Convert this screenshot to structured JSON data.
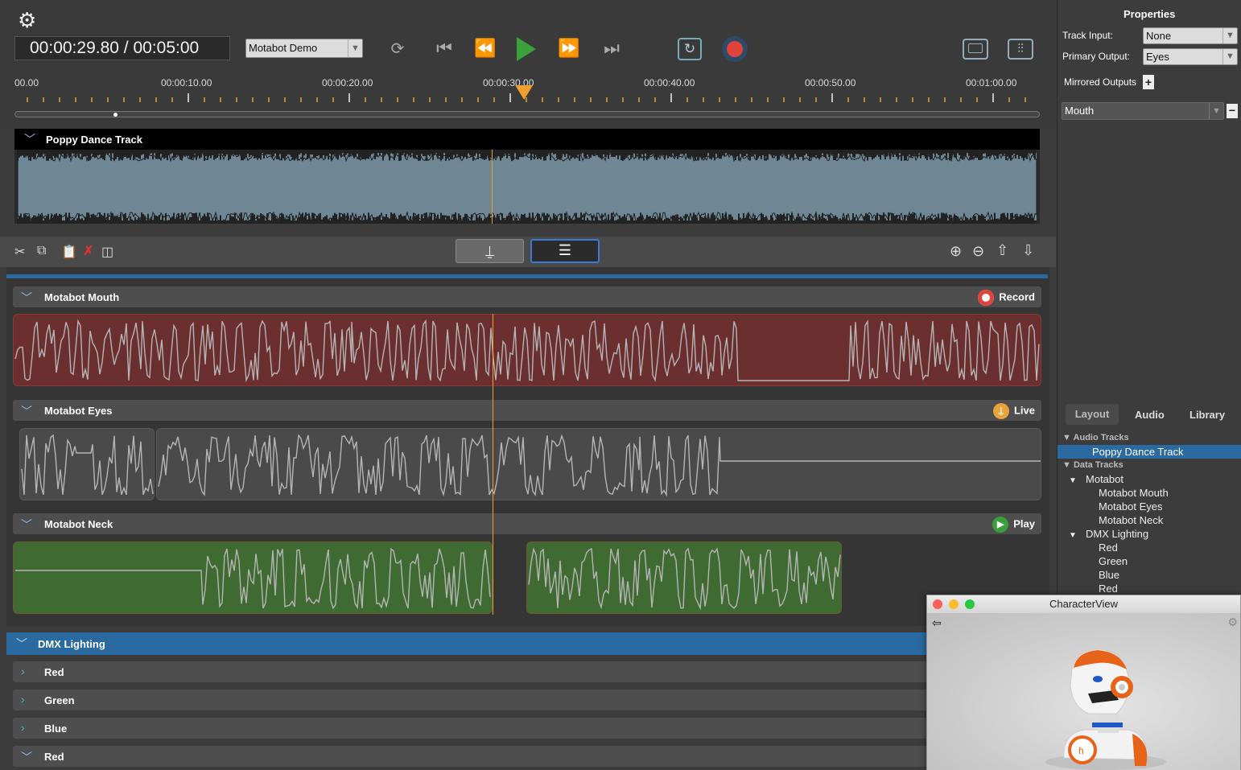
{
  "transport": {
    "current_time": "00:00:29.80",
    "total_time": " / 00:05:00",
    "project_select": "Motabot Demo"
  },
  "ruler": {
    "ticks": [
      "00.00",
      "00:00:10.00",
      "00:00:20.00",
      "00:00:30.00",
      "00:00:40.00",
      "00:00:50.00",
      "00:01:00.00"
    ],
    "playhead_fraction": 0.497
  },
  "audio_track": {
    "name": "Poppy Dance Track"
  },
  "tracks": [
    {
      "name": "Motabot Mouth",
      "status": "Record",
      "color": "#6b2f2f"
    },
    {
      "name": "Motabot Eyes",
      "status": "Live",
      "color": "#4a4a4a"
    },
    {
      "name": "Motabot Neck",
      "status": "Play",
      "color": "#3f6b33"
    }
  ],
  "dmx": {
    "group": "DMX Lighting",
    "channels": [
      "Red",
      "Green",
      "Blue",
      "Red"
    ]
  },
  "properties": {
    "title": "Properties",
    "track_input_label": "Track Input:",
    "track_input_value": "None",
    "primary_output_label": "Primary Output:",
    "primary_output_value": "Eyes",
    "mirrored_outputs_label": "Mirrored Outputs",
    "mirrored_value": "Mouth"
  },
  "panel_tabs": [
    "Layout",
    "Audio",
    "Library"
  ],
  "tree": {
    "audio_tracks": "Audio Tracks",
    "audio_items": [
      "Poppy Dance Track"
    ],
    "data_tracks": "Data Tracks",
    "motabot": "Motabot",
    "motabot_items": [
      "Motabot Mouth",
      "Motabot Eyes",
      "Motabot Neck"
    ],
    "dmx": "DMX Lighting",
    "dmx_items": [
      "Red",
      "Green",
      "Blue",
      "Red"
    ]
  },
  "character_view": {
    "title": "CharacterView"
  },
  "colors": {
    "accent": "#2a6aa0",
    "record": "#e0433a",
    "play": "#3aa03a",
    "live": "#e8a33a",
    "playhead": "#f0a030"
  }
}
